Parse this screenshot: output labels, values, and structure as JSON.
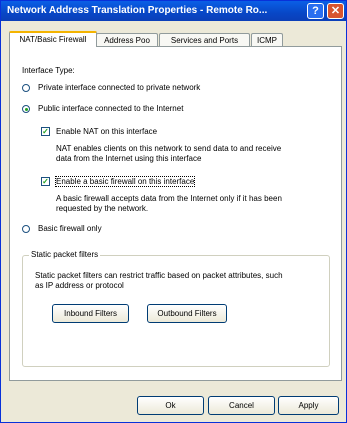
{
  "window": {
    "title": "Network Address Translation Properties - Remote Ro..."
  },
  "titlebar": {
    "help_glyph": "?",
    "close_glyph": "✕"
  },
  "tabs": [
    {
      "label": "NAT/Basic Firewall",
      "active": true
    },
    {
      "label": "Address Poo"
    },
    {
      "label": "Services and Ports"
    },
    {
      "label": "ICMP"
    }
  ],
  "interface": {
    "heading": "Interface Type:",
    "private_label": "Private interface connected to private network",
    "public_label": "Public interface connected to the Internet",
    "enable_nat_label": "Enable NAT on this interface",
    "enable_nat_desc_1": "NAT enables clients on this network to send data to and receive",
    "enable_nat_desc_2": "data from the Internet using this interface",
    "firewall_label": "Enable a basic firewall on this interface",
    "firewall_desc_1": "A basic firewall accepts data from the Internet only if it has been",
    "firewall_desc_2": "requested by the network.",
    "basic_firewall_only_label": "Basic firewall only"
  },
  "filters": {
    "group_label": "Static packet filters",
    "desc_1": "Static packet filters can restrict traffic based on packet attributes, such",
    "desc_2": "as IP address or protocol",
    "inbound_label": "Inbound Filters",
    "outbound_label": "Outbound Filters"
  },
  "footer": {
    "ok_label": "Ok",
    "cancel_label": "Cancel",
    "apply_label": "Apply"
  },
  "state": {
    "selected_interface": "public",
    "enable_nat": true,
    "enable_firewall": true
  }
}
